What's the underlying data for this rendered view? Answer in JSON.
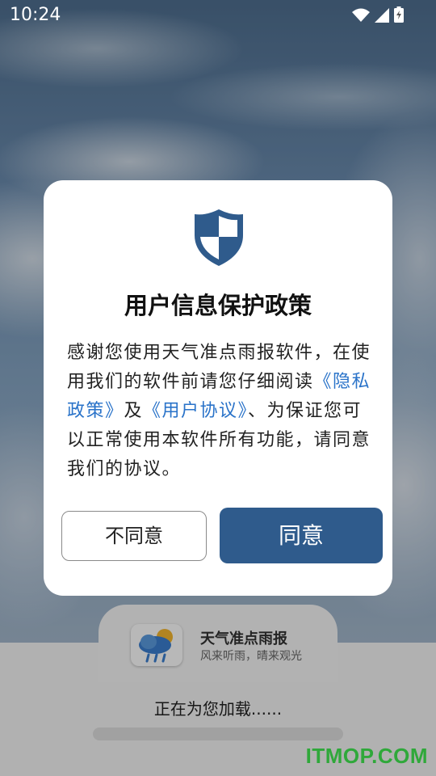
{
  "status_bar": {
    "time": "10:24",
    "icons": [
      "wifi-icon",
      "signal-icon",
      "battery-charging-icon"
    ]
  },
  "dialog": {
    "title": "用户信息保护政策",
    "body_prefix": "感谢您使用天气准点雨报软件，在使用我们的软件前请您仔细阅读",
    "privacy_link": "《隐私政策》",
    "conjunction": "及",
    "agreement_link": "《用户协议》",
    "body_suffix": "、为保证您可以正常使用本软件所有功能，请同意我们的协议。",
    "disagree_label": "不同意",
    "agree_label": "同意",
    "accent_color": "#2f5b8c",
    "link_color": "#2a73c9"
  },
  "app": {
    "name": "天气准点雨报",
    "slogan": "风来听雨，晴来观光",
    "loading_text": "正在为您加载......"
  },
  "watermark": "ITMOP.COM"
}
